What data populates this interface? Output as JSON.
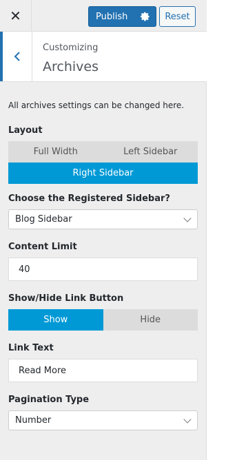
{
  "header": {
    "close_label": "✕",
    "publish_label": "Publish",
    "publish_gear_icon": "gear-icon",
    "reset_label": "Reset"
  },
  "section": {
    "back_icon": "chevron-left-icon",
    "breadcrumb": "Customizing",
    "title": "Archives"
  },
  "controls": {
    "description": "All archives settings can be changed here.",
    "layout": {
      "label": "Layout",
      "options": [
        "Full Width",
        "Left Sidebar",
        "Right Sidebar"
      ],
      "selected": "Right Sidebar"
    },
    "sidebar": {
      "label": "Choose the Registered Sidebar?",
      "value": "Blog Sidebar"
    },
    "content_limit": {
      "label": "Content Limit",
      "value": "40"
    },
    "link_button": {
      "label": "Show/Hide Link Button",
      "options": [
        "Show",
        "Hide"
      ],
      "selected": "Show"
    },
    "link_text": {
      "label": "Link Text",
      "value": "Read More"
    },
    "pagination": {
      "label": "Pagination Type",
      "value": "Number"
    }
  },
  "colors": {
    "accent": "#2271b1",
    "segment_active": "#0099d6",
    "panel_bg": "#eeeeee"
  }
}
